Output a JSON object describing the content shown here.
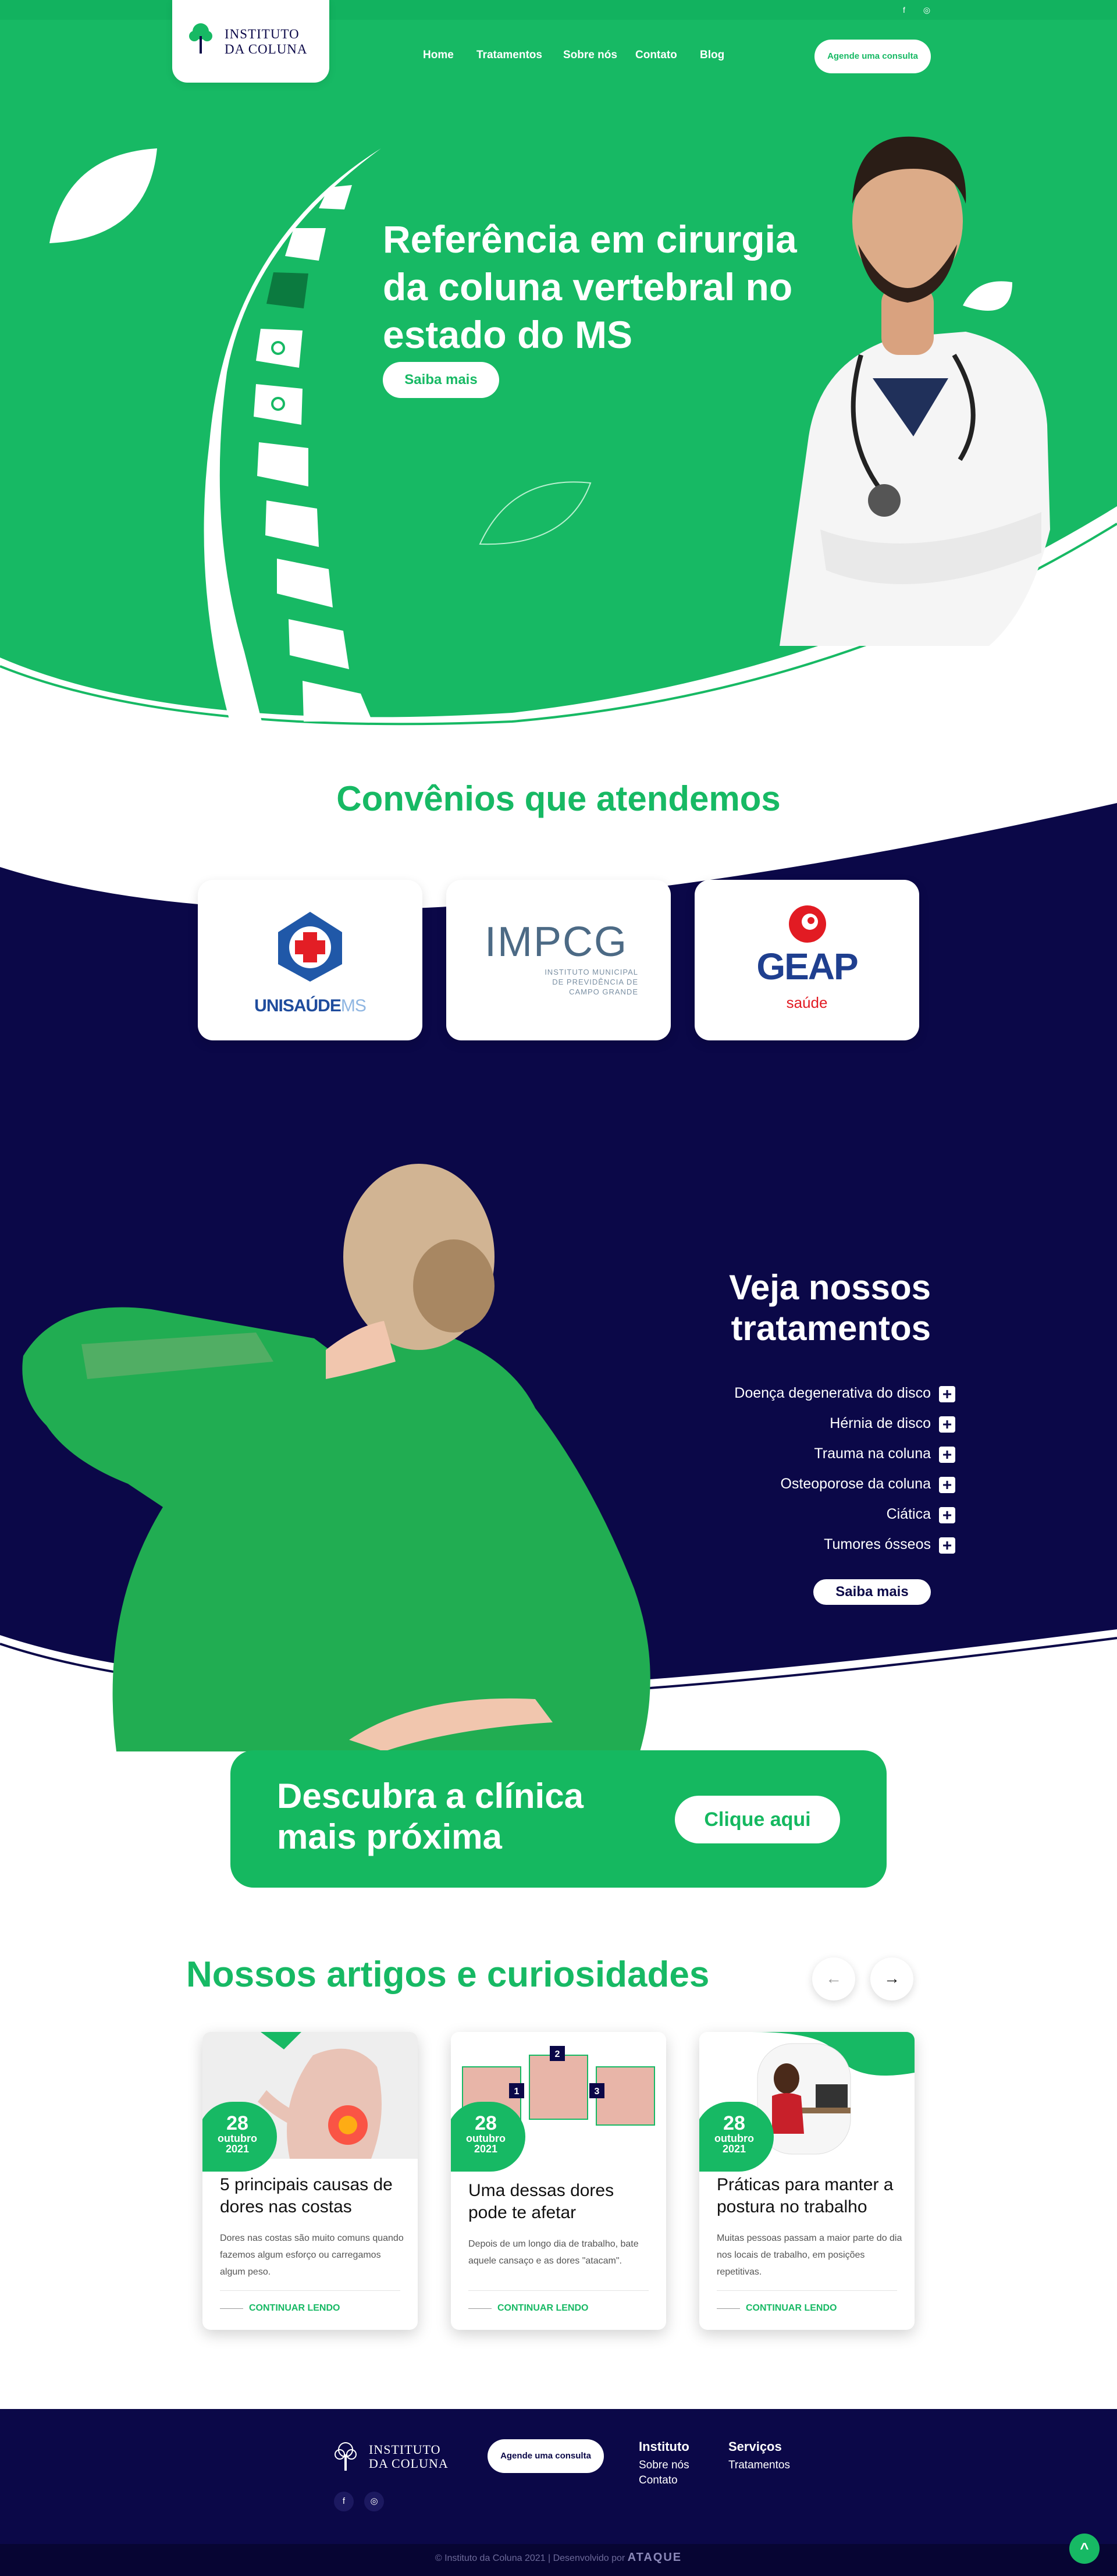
{
  "brand": {
    "name_line1": "INSTITUTO",
    "name_line2": "DA COLUNA",
    "primary": "#17b964",
    "navy": "#0b0848"
  },
  "topbar": {
    "icons": [
      "facebook-icon",
      "instagram-icon"
    ],
    "facebook": "f",
    "instagram": "◎"
  },
  "nav": {
    "items": [
      "Home",
      "Tratamentos",
      "Sobre nós",
      "Contato",
      "Blog"
    ],
    "cta": "Agende uma consulta"
  },
  "hero": {
    "title": "Referência em cirurgia da coluna vertebral no estado do MS",
    "button": "Saiba mais"
  },
  "convenios": {
    "title": "Convênios que atendemos",
    "items": [
      {
        "name": "UNISAÚDE",
        "suffix": "MS"
      },
      {
        "name": "IMPCG",
        "subtitle_l1": "INSTITUTO MUNICIPAL",
        "subtitle_l2": "DE PREVIDÊNCIA DE",
        "subtitle_l3": "CAMPO GRANDE"
      },
      {
        "name": "GEAP",
        "subtitle": "saúde"
      }
    ]
  },
  "treatments": {
    "title": "Veja nossos tratamentos",
    "items": [
      "Doença degenerativa do disco",
      "Hérnia de disco",
      "Trauma na coluna",
      "Osteoporose da coluna",
      "Ciática",
      "Tumores ósseos"
    ],
    "button": "Saiba mais",
    "plus": "+"
  },
  "clinic": {
    "title": "Descubra a clínica mais próxima",
    "button": "Clique aqui"
  },
  "articles": {
    "title": "Nossos artigos e curiosidades",
    "prev": "←",
    "next": "→",
    "items": [
      {
        "day": "28",
        "month": "outubro",
        "year": "2021",
        "title": "5 principais causas de dores nas costas",
        "text": "Dores nas costas são muito comuns quando fazemos algum esforço ou carregamos algum peso.",
        "more": "CONTINUAR LENDO"
      },
      {
        "day": "28",
        "month": "outubro",
        "year": "2021",
        "title": "Uma dessas dores pode te afetar",
        "text": "Depois de um longo dia de trabalho, bate aquele cansaço e as dores \"atacam\".",
        "more": "CONTINUAR LENDO",
        "num1": "1",
        "num2": "2",
        "num3": "3"
      },
      {
        "day": "28",
        "month": "outubro",
        "year": "2021",
        "title": "Práticas para manter a postura no trabalho",
        "text": "Muitas pessoas passam a maior parte do dia nos locais de trabalho, em posições repetitivas.",
        "more": "CONTINUAR LENDO"
      }
    ]
  },
  "footer": {
    "cta": "Agende uma consulta",
    "col1": {
      "head": "Instituto",
      "links": [
        "Sobre nós",
        "Contato"
      ]
    },
    "col2": {
      "head": "Serviços",
      "links": [
        "Tratamentos"
      ]
    },
    "copyright": "© Instituto da Coluna 2021 | Desenvolvido por",
    "dev": "ATAQUE",
    "top": "^"
  }
}
